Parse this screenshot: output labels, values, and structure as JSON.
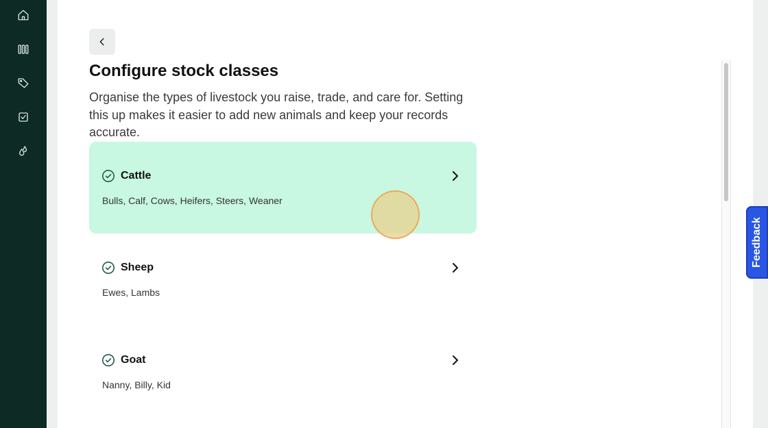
{
  "sidebar": {
    "items": [
      {
        "icon": "home-icon"
      },
      {
        "icon": "paddocks-icon"
      },
      {
        "icon": "tag-icon"
      },
      {
        "icon": "task-check-icon"
      },
      {
        "icon": "drops-icon"
      }
    ]
  },
  "header": {
    "back_icon": "chevron-left-icon",
    "title": "Configure stock classes",
    "description": "Organise the types of livestock you raise, trade, and care for. Setting this up makes it easier to add new animals and keep your records accurate."
  },
  "stock_classes": [
    {
      "name": "Cattle",
      "subclasses": "Bulls, Calf, Cows, Heifers, Steers, Weaner",
      "selected": true
    },
    {
      "name": "Sheep",
      "subclasses": "Ewes, Lambs",
      "selected": false
    },
    {
      "name": "Goat",
      "subclasses": "Nanny, Billy, Kid",
      "selected": false
    }
  ],
  "feedback": {
    "label": "Feedback"
  },
  "colors": {
    "sidebar_bg": "#0d2a25",
    "selected_card_bg": "#c8f7e2",
    "feedback_bg": "#2a55e5",
    "check_stroke": "#1f5a4a"
  }
}
